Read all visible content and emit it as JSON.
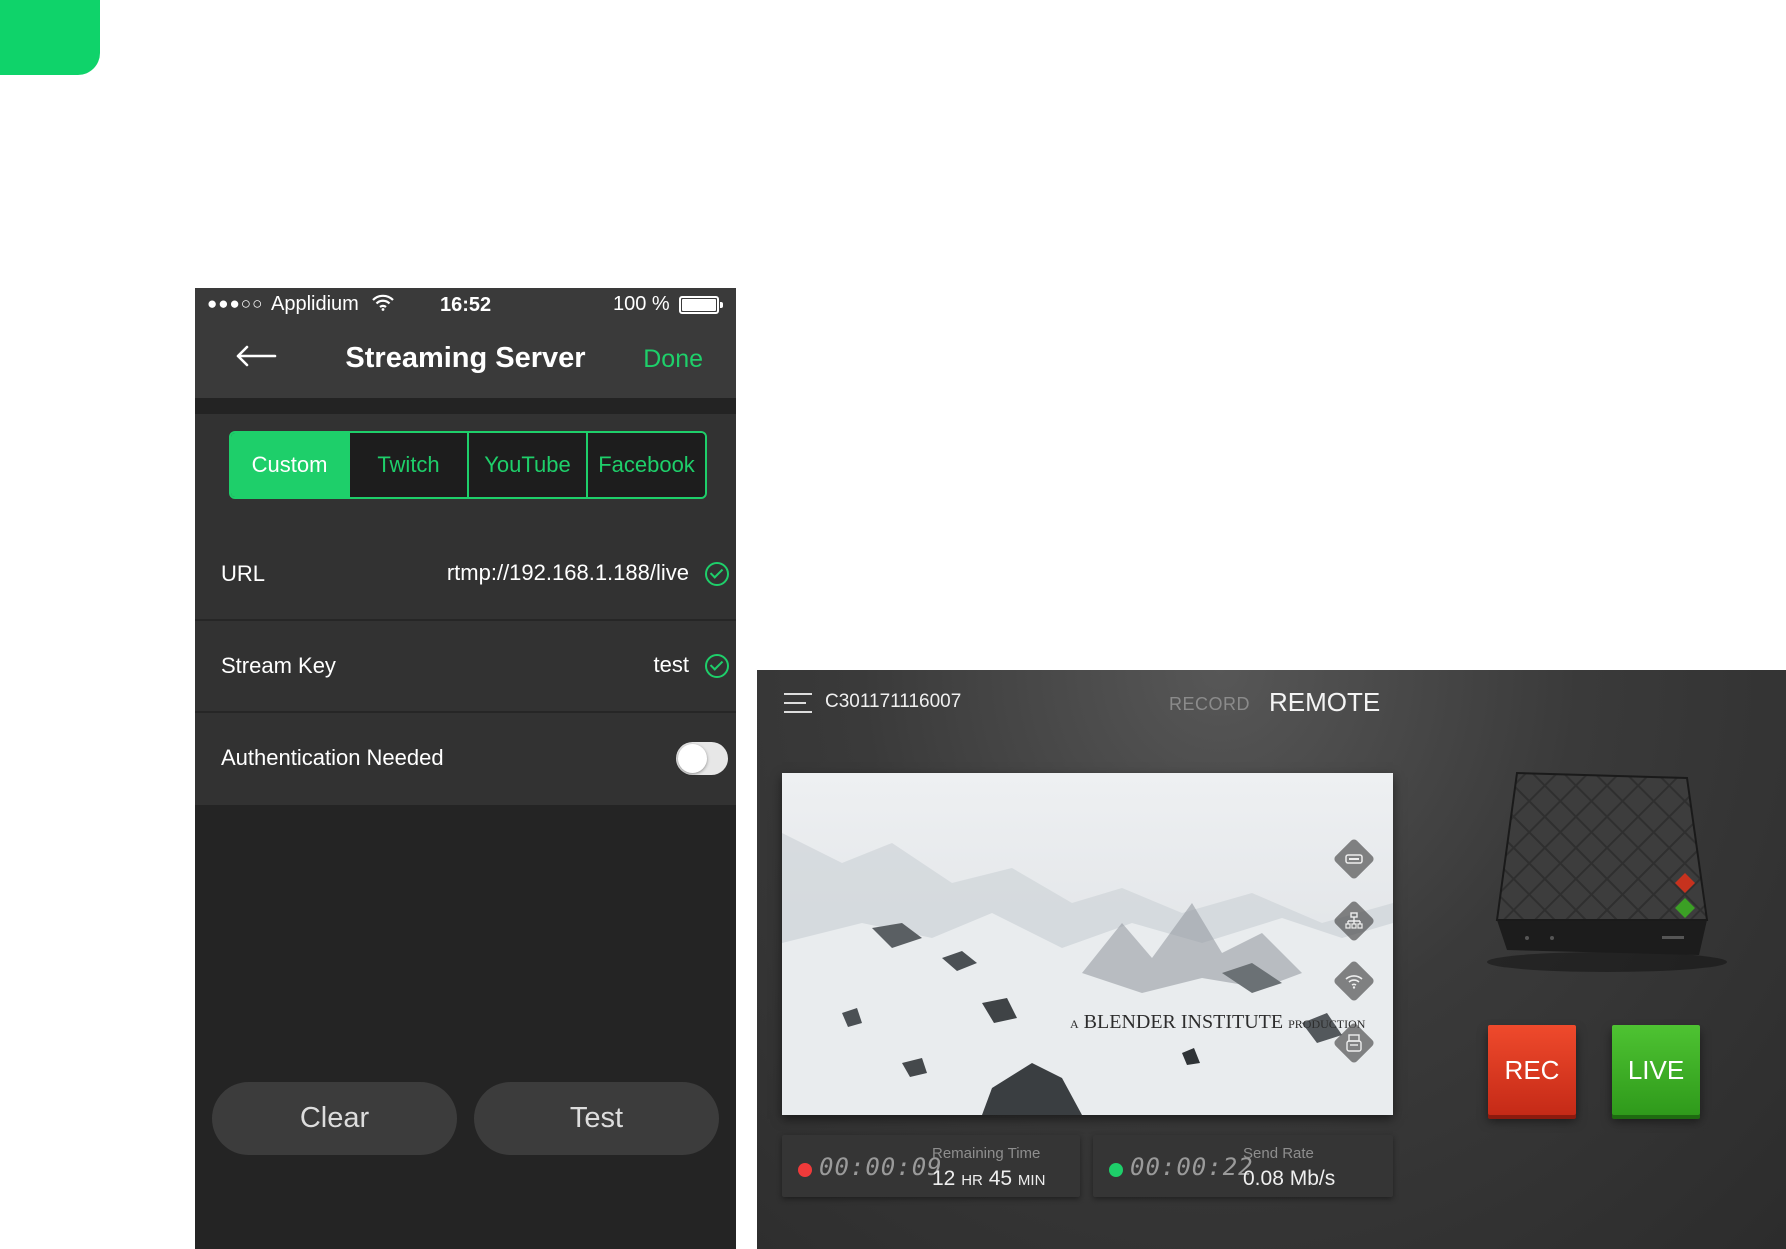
{
  "phone": {
    "status_bar": {
      "signal": "●●●○○",
      "carrier": "Applidium",
      "time": "16:52",
      "battery": "100 %"
    },
    "nav": {
      "title": "Streaming Server",
      "done_label": "Done"
    },
    "segments": {
      "options": [
        "Custom",
        "Twitch",
        "YouTube",
        "Facebook"
      ],
      "selected": "Custom"
    },
    "form": {
      "url_label": "URL",
      "url_value": "rtmp://192.168.1.188/live",
      "stream_key_label": "Stream Key",
      "stream_key_value": "test",
      "auth_label": "Authentication Needed",
      "auth_enabled": false
    },
    "buttons": {
      "clear_label": "Clear",
      "test_label": "Test"
    }
  },
  "remote": {
    "device_id": "C301171116007",
    "tabs": {
      "record_label": "RECORD",
      "remote_label": "REMOTE",
      "active": "REMOTE"
    },
    "preview": {
      "credit_a": "A",
      "credit_main": "BLENDER INSTITUTE",
      "credit_prod": "PRODUCTION",
      "port_icons": [
        "hdmi-icon",
        "ethernet-icon",
        "wifi-icon",
        "usb-storage-icon"
      ]
    },
    "record_stat": {
      "time": "00:00:09",
      "label": "Remaining Time",
      "hours": "12",
      "hr_unit": "HR",
      "minutes": "45",
      "min_unit": "MIN",
      "dot_color": "#f03a3a"
    },
    "live_stat": {
      "time": "00:00:22",
      "label": "Send Rate",
      "value": "0.08 Mb/s",
      "dot_color": "#1ecf6a"
    },
    "rec_label": "REC",
    "live_label": "LIVE"
  },
  "colors": {
    "accent_green": "#1ecf6a",
    "rec_red": "#e03a22",
    "live_green": "#3fb428"
  }
}
